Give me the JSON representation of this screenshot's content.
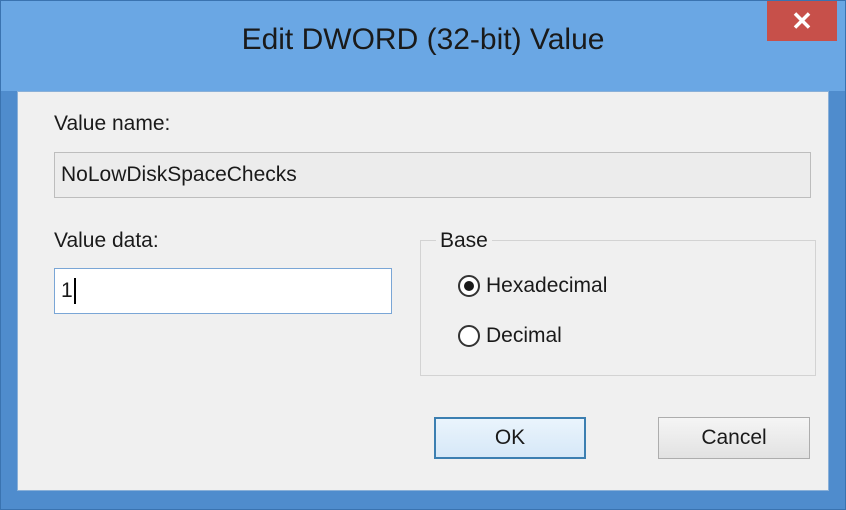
{
  "window": {
    "title": "Edit DWORD (32-bit) Value",
    "close_glyph": "✕"
  },
  "value_name": {
    "label": "Value name:",
    "value": "NoLowDiskSpaceChecks"
  },
  "value_data": {
    "label": "Value data:",
    "value": "1"
  },
  "base": {
    "legend": "Base",
    "options": [
      {
        "label": "Hexadecimal",
        "checked": true
      },
      {
        "label": "Decimal",
        "checked": false
      }
    ]
  },
  "buttons": {
    "ok_label": "OK",
    "cancel_label": "Cancel"
  },
  "colors": {
    "titlebar": "#6aa7e4",
    "close_button": "#c7504a",
    "dialog_background": "#f0f0f0"
  }
}
